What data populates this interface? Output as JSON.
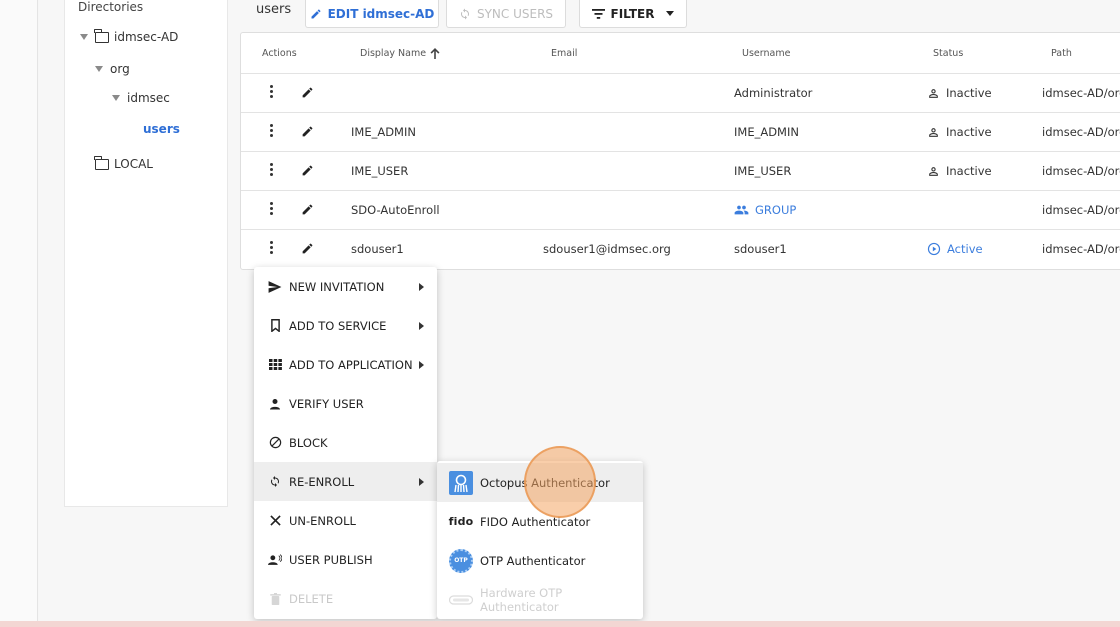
{
  "tree": {
    "title": "Directories",
    "nodes": [
      {
        "label": "idmsec-AD"
      },
      {
        "label": "org"
      },
      {
        "label": "idmsec"
      },
      {
        "label": "users"
      },
      {
        "label": "LOCAL"
      }
    ]
  },
  "toolbar": {
    "context_label": "users",
    "edit_label": "EDIT idmsec-AD",
    "sync_label": "SYNC USERS",
    "filter_label": "FILTER"
  },
  "table": {
    "headers": [
      "Actions",
      "Display Name",
      "Email",
      "Username",
      "Status",
      "Path"
    ],
    "rows": [
      {
        "display_name": "",
        "email": "",
        "username": "Administrator",
        "status": "Inactive",
        "path": "idmsec-AD/org/"
      },
      {
        "display_name": "IME_ADMIN",
        "email": "",
        "username": "IME_ADMIN",
        "status": "Inactive",
        "path": "idmsec-AD/org/"
      },
      {
        "display_name": "IME_USER",
        "email": "",
        "username": "IME_USER",
        "status": "Inactive",
        "path": "idmsec-AD/org/"
      },
      {
        "display_name": "SDO-AutoEnroll",
        "email": "",
        "username": "GROUP",
        "status": "",
        "path": "idmsec-AD/org/"
      },
      {
        "display_name": "sdouser1",
        "email": "sdouser1@idmsec.org",
        "username": "sdouser1",
        "status": "Active",
        "path": "idmsec-AD/org/"
      }
    ]
  },
  "context_menu": {
    "items": [
      {
        "label": "NEW INVITATION",
        "icon": "send-icon"
      },
      {
        "label": "ADD TO SERVICE",
        "icon": "bookmark-icon"
      },
      {
        "label": "ADD TO APPLICATION",
        "icon": "grid-icon"
      },
      {
        "label": "VERIFY USER",
        "icon": "person-icon"
      },
      {
        "label": "BLOCK",
        "icon": "block-icon"
      },
      {
        "label": "RE-ENROLL",
        "icon": "refresh-icon"
      },
      {
        "label": "UN-ENROLL",
        "icon": "close-icon"
      },
      {
        "label": "USER PUBLISH",
        "icon": "publish-icon"
      },
      {
        "label": "DELETE",
        "icon": "trash-icon"
      }
    ]
  },
  "submenu": {
    "items": [
      {
        "label": "Octopus Authenticator",
        "icon": "octopus-icon"
      },
      {
        "label": "FIDO Authenticator",
        "icon": "fido-icon",
        "logo_text": "fido"
      },
      {
        "label": "OTP Authenticator",
        "icon": "otp-icon",
        "logo_text": "OTP"
      },
      {
        "label": "Hardware OTP Authenticator",
        "icon": "hardware-token-icon"
      }
    ]
  },
  "colors": {
    "accent": "#2f6fd6",
    "link": "#3b7ddd",
    "highlight": "#f4a564"
  }
}
